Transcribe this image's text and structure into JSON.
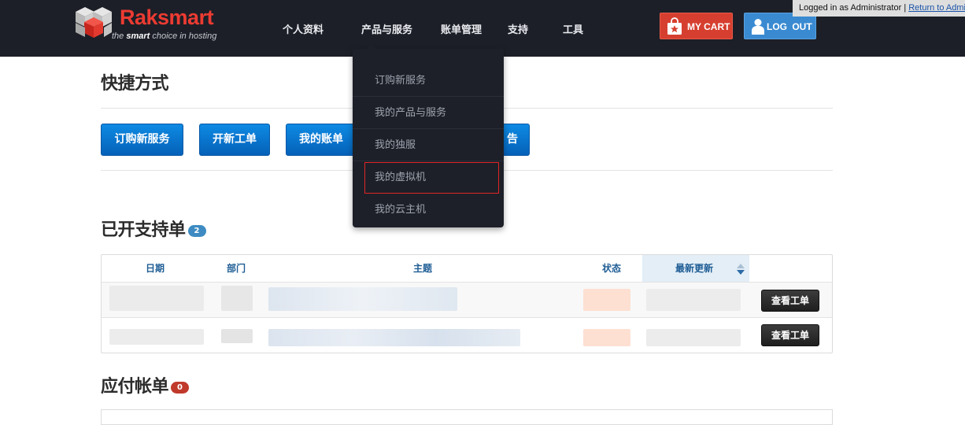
{
  "header": {
    "logo": {
      "name": "Raksmart",
      "tagline_prefix": "the ",
      "tagline_bold": "smart",
      "tagline_suffix": " choice in hosting"
    },
    "nav": [
      "个人资料",
      "产品与服务",
      "账单管理",
      "支持",
      "工具"
    ],
    "cart_label": "MY CART",
    "logout_label": "LOG OUT",
    "colors": {
      "bar": "#1c1f27",
      "cart": "#d63f2f",
      "logout": "#3a8ad1",
      "brand": "#ec3b32"
    }
  },
  "admin_bar": {
    "text": "Logged in as Administrator",
    "separator": "|",
    "link": "Return to Admin"
  },
  "dropdown": {
    "items": [
      "订购新服务",
      "我的产品与服务",
      "我的独服",
      "我的虚拟机",
      "我的云主机"
    ],
    "active_index": 3
  },
  "shortcuts": {
    "title": "快捷方式",
    "buttons": [
      "订购新服务",
      "开新工单",
      "我的账单",
      "告"
    ]
  },
  "tickets": {
    "title": "已开支持单",
    "count": "2",
    "badge_color": "#3d8bc2",
    "columns": [
      "日期",
      "部门",
      "主题",
      "状态",
      "最新更新"
    ],
    "sorted_column": "最新更新",
    "rows": [
      {
        "action": "查看工单"
      },
      {
        "action": "查看工单"
      }
    ]
  },
  "invoices": {
    "title": "应付帐单",
    "count": "0",
    "badge_color": "#c0392b"
  }
}
